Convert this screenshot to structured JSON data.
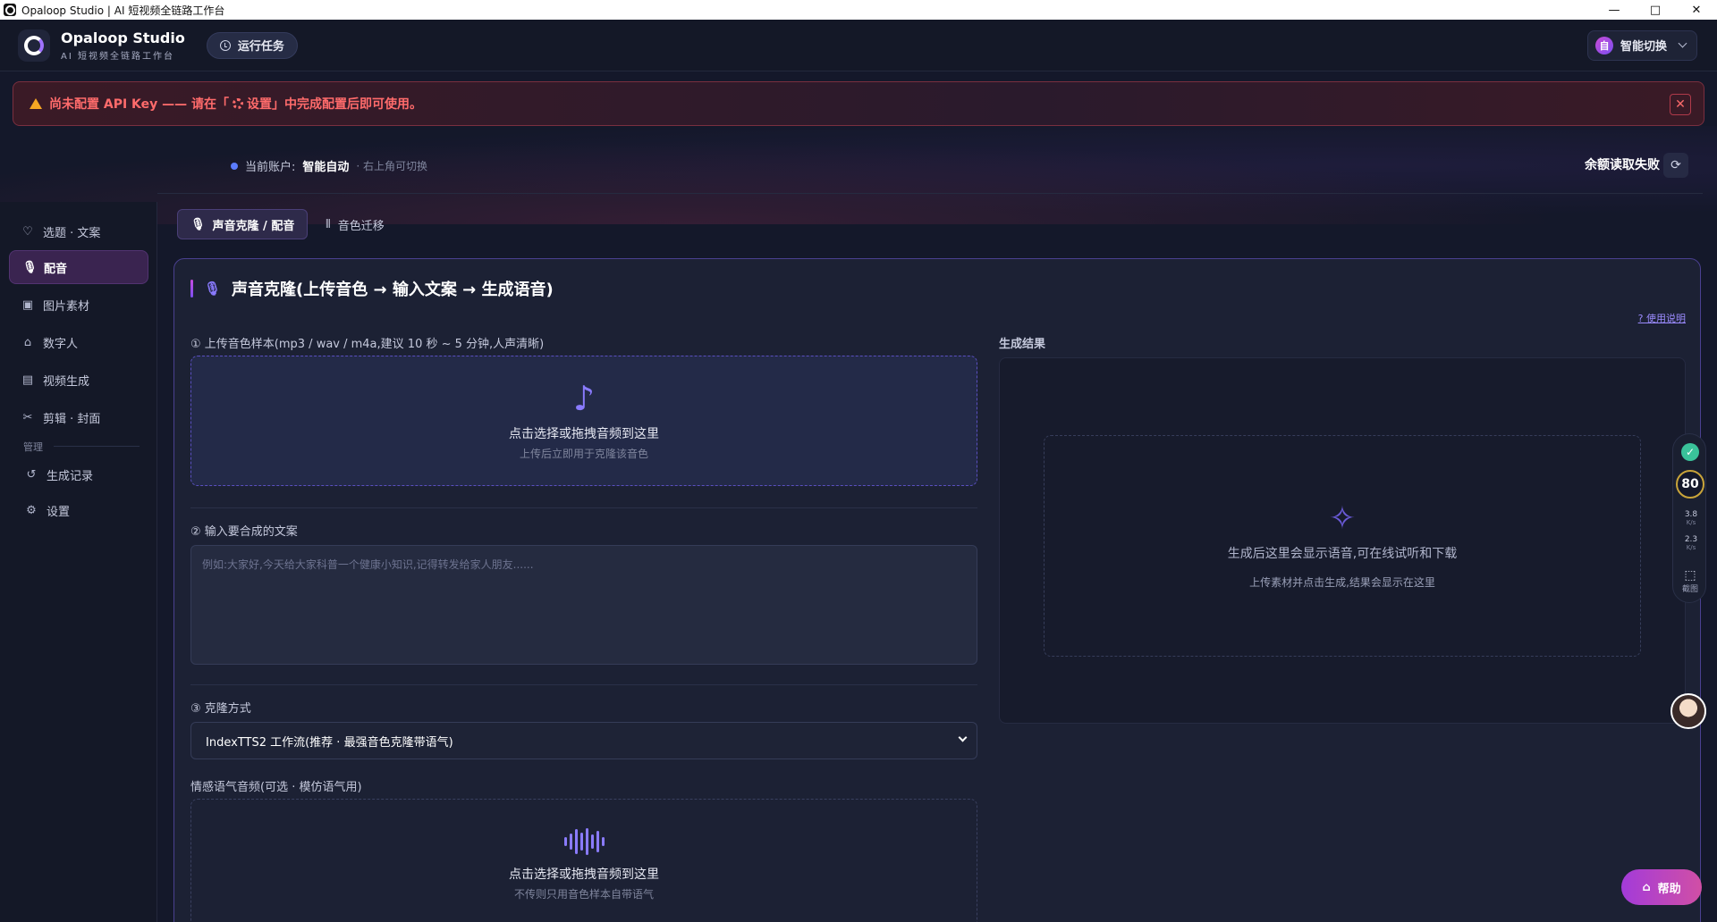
{
  "window": {
    "title": "Opaloop Studio | AI 短视频全链路工作台",
    "controls": [
      "—",
      "□",
      "✕"
    ]
  },
  "header": {
    "brand_name": "Opaloop Studio",
    "brand_sub": "AI 短视频全链路工作台",
    "run_tasks": "运行任务",
    "account_avatar": "自",
    "account_switch": "智能切换"
  },
  "banner": {
    "part1": "尚未配置 API Key —— 请在「",
    "part2": "设置」中完成配置后即可使用。",
    "close": "✕"
  },
  "account": {
    "label": "当前账户:",
    "name": "智能自动",
    "hint": "· 右上角可切换",
    "balance": "余额读取失败",
    "refresh": "⟳"
  },
  "sidebar": {
    "items": [
      {
        "icon": "lightbulb-icon",
        "glyph": "♡",
        "label": "选题 · 文案"
      },
      {
        "icon": "mic-icon",
        "glyph": "🎙",
        "label": "配音"
      },
      {
        "icon": "image-icon",
        "glyph": "▣",
        "label": "图片素材"
      },
      {
        "icon": "robot-icon",
        "glyph": "⌂",
        "label": "数字人"
      },
      {
        "icon": "film-icon",
        "glyph": "▤",
        "label": "视频生成"
      },
      {
        "icon": "scissors-icon",
        "glyph": "✂",
        "label": "剪辑 · 封面"
      }
    ],
    "group_label": "管理",
    "manage_items": [
      {
        "icon": "history-icon",
        "glyph": "↺",
        "label": "生成记录"
      },
      {
        "icon": "gear-icon",
        "glyph": "⚙",
        "label": "设置"
      }
    ]
  },
  "tabs": [
    {
      "icon": "mic-icon",
      "glyph": "🎙",
      "label": "声音克隆 / 配音"
    },
    {
      "icon": "waveform-icon",
      "glyph": "⦀",
      "label": "音色迁移"
    }
  ],
  "card": {
    "title": "声音克隆(上传音色 → 输入文案 → 生成语音)",
    "help_link": "? 使用说明",
    "step1_label": "① 上传音色样本(mp3 / wav / m4a,建议 10 秒 ~ 5 分钟,人声清晰)",
    "upload1_main": "点击选择或拖拽音频到这里",
    "upload1_sub": "上传后立即用于克隆该音色",
    "step2_label": "② 输入要合成的文案",
    "text_placeholder": "例如:大家好,今天给大家科普一个健康小知识,记得转发给家人朋友......",
    "step3_label": "③ 克隆方式",
    "clone_method": "IndexTTS2 工作流(推荐 · 最强音色克隆带语气)",
    "emotion_label": "情感语气音频(可选 · 模仿语气用)",
    "upload2_main": "点击选择或拖拽音频到这里",
    "upload2_sub": "不传则只用音色样本自带语气",
    "result_label": "生成结果",
    "result_main": "生成后这里会显示语音,可在线试听和下载",
    "result_sub": "上传素材并点击生成,结果会显示在这里"
  },
  "widget": {
    "check": "✓",
    "score": "80",
    "up_rate": "3.8",
    "down_rate": "2.3",
    "rate_unit": "K/s",
    "screenshot": "截图"
  },
  "help_button": "帮助"
}
